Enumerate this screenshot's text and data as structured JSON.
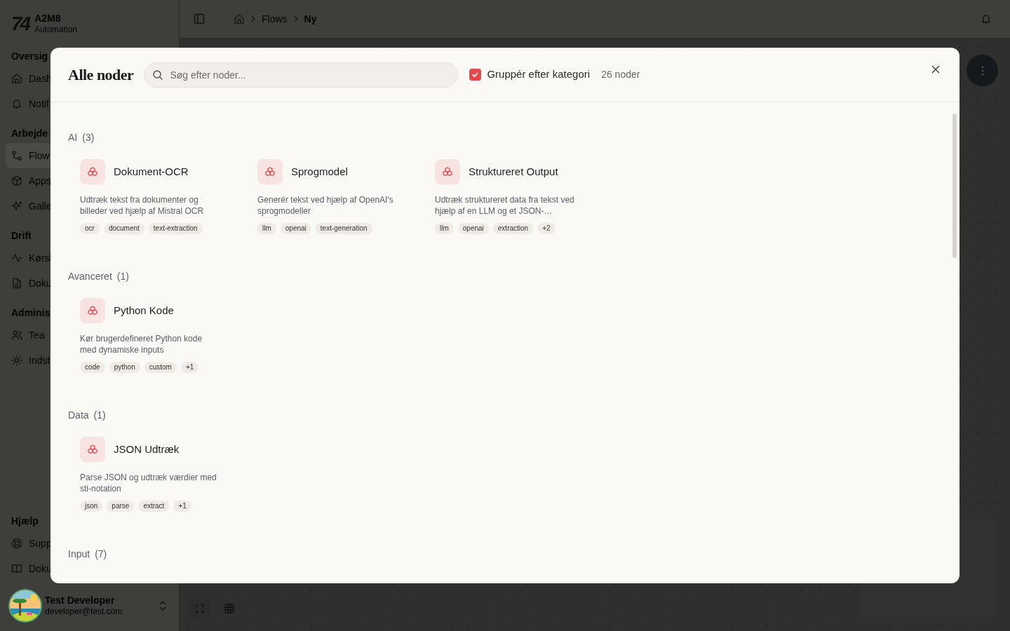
{
  "app": {
    "logo": "74",
    "name": "A2M8",
    "subtitle": "Automation"
  },
  "sidebar": {
    "sections": [
      {
        "title": "Oversig",
        "items": [
          {
            "label": "Dash",
            "kind": "home",
            "selected": false
          },
          {
            "label": "Notif",
            "kind": "bell",
            "selected": false
          }
        ]
      },
      {
        "title": "Arbejde",
        "items": [
          {
            "label": "Flow",
            "kind": "flows",
            "selected": true
          },
          {
            "label": "Apps",
            "kind": "box",
            "selected": false
          },
          {
            "label": "Galle",
            "kind": "sparkles",
            "selected": false
          }
        ]
      },
      {
        "title": "Drift",
        "items": [
          {
            "label": "Kørsl",
            "kind": "activity",
            "selected": false
          },
          {
            "label": "Doku",
            "kind": "file",
            "selected": false
          }
        ]
      },
      {
        "title": "Adminis",
        "items": [
          {
            "label": "Tea",
            "kind": "users",
            "selected": false
          },
          {
            "label": "Indst",
            "kind": "gear",
            "selected": false
          }
        ]
      },
      {
        "title": "Hjælp",
        "items": [
          {
            "label": "Supp",
            "kind": "lifebuoy",
            "selected": false
          },
          {
            "label": "Doku",
            "kind": "book",
            "selected": false
          }
        ]
      }
    ],
    "user": {
      "name": "Test Developer",
      "email": "developer@test.com"
    }
  },
  "breadcrumb": [
    "Flows",
    "Ny"
  ],
  "modal": {
    "title": "Alle noder",
    "search": {
      "placeholder": "Søg efter noder..."
    },
    "group_by": {
      "label": "Gruppér efter kategori",
      "checked": true
    },
    "count": "26 noder",
    "categories": [
      {
        "name": "AI",
        "count": "(3)",
        "nodes": [
          {
            "title": "Dokument-OCR",
            "description": "Udtræk tekst fra dokumenter og billeder ved hjælp af Mistral OCR",
            "tags": [
              "ocr",
              "document",
              "text-extraction"
            ]
          },
          {
            "title": "Sprogmodel",
            "description": "Generér tekst ved hjælp af OpenAI's sprogmodeller",
            "tags": [
              "llm",
              "openai",
              "text-generation"
            ]
          },
          {
            "title": "Struktureret Output",
            "description": "Udtræk struktureret data fra tekst ved hjælp af en LLM og et JSON-…",
            "tags": [
              "llm",
              "openai",
              "extraction",
              "+2"
            ]
          }
        ]
      },
      {
        "name": "Avanceret",
        "count": "(1)",
        "nodes": [
          {
            "title": "Python Kode",
            "description": "Kør brugerdefineret Python kode med dynamiske inputs",
            "tags": [
              "code",
              "python",
              "custom",
              "+1"
            ]
          }
        ]
      },
      {
        "name": "Data",
        "count": "(1)",
        "nodes": [
          {
            "title": "JSON Udtræk",
            "description": "Parse JSON og udtræk værdier med sti-notation",
            "tags": [
              "json",
              "parse",
              "extract",
              "+1"
            ]
          }
        ]
      },
      {
        "name": "Input",
        "count": "(7)"
      }
    ]
  }
}
